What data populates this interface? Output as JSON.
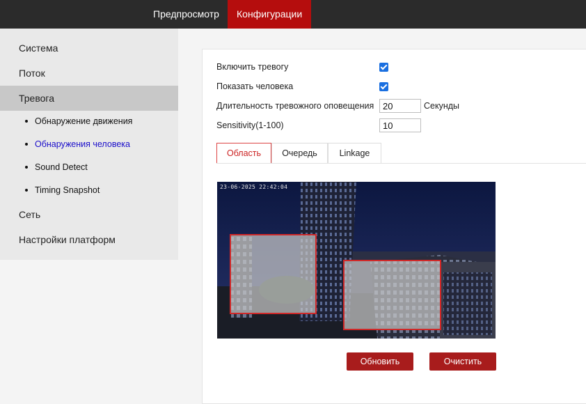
{
  "header": {
    "tabs": [
      {
        "label": "Предпросмотр",
        "active": false
      },
      {
        "label": "Конфигурации",
        "active": true
      }
    ],
    "accent_color": "#b50d0d"
  },
  "sidebar": {
    "items": [
      {
        "label": "Система"
      },
      {
        "label": "Поток"
      },
      {
        "label": "Тревога",
        "active": true
      },
      {
        "label": "Сеть"
      },
      {
        "label": "Настройки платформ"
      }
    ],
    "sub_items": [
      {
        "label": "Обнаружение движения"
      },
      {
        "label": "Обнаружения человека",
        "active": true
      },
      {
        "label": "Sound Detect"
      },
      {
        "label": "Timing Snapshot"
      }
    ]
  },
  "form": {
    "enable_alarm": {
      "label": "Включить тревогу",
      "checked": true
    },
    "show_person": {
      "label": "Показать человека",
      "checked": true
    },
    "alarm_duration": {
      "label": "Длительность тревожного оповещения",
      "value": "20",
      "unit": "Секунды"
    },
    "sensitivity": {
      "label": "Sensitivity(1-100)",
      "value": "10"
    }
  },
  "content_tabs": [
    {
      "label": "Область",
      "active": true
    },
    {
      "label": "Очередь",
      "active": false
    },
    {
      "label": "Linkage",
      "active": false
    }
  ],
  "video": {
    "timestamp": "23-06-2025 22:42:04"
  },
  "buttons": {
    "refresh": "Обновить",
    "clear": "Очистить"
  },
  "colors": {
    "button": "#a81c1c",
    "zone_border": "#d02828",
    "checkbox": "#1a6fe0"
  }
}
